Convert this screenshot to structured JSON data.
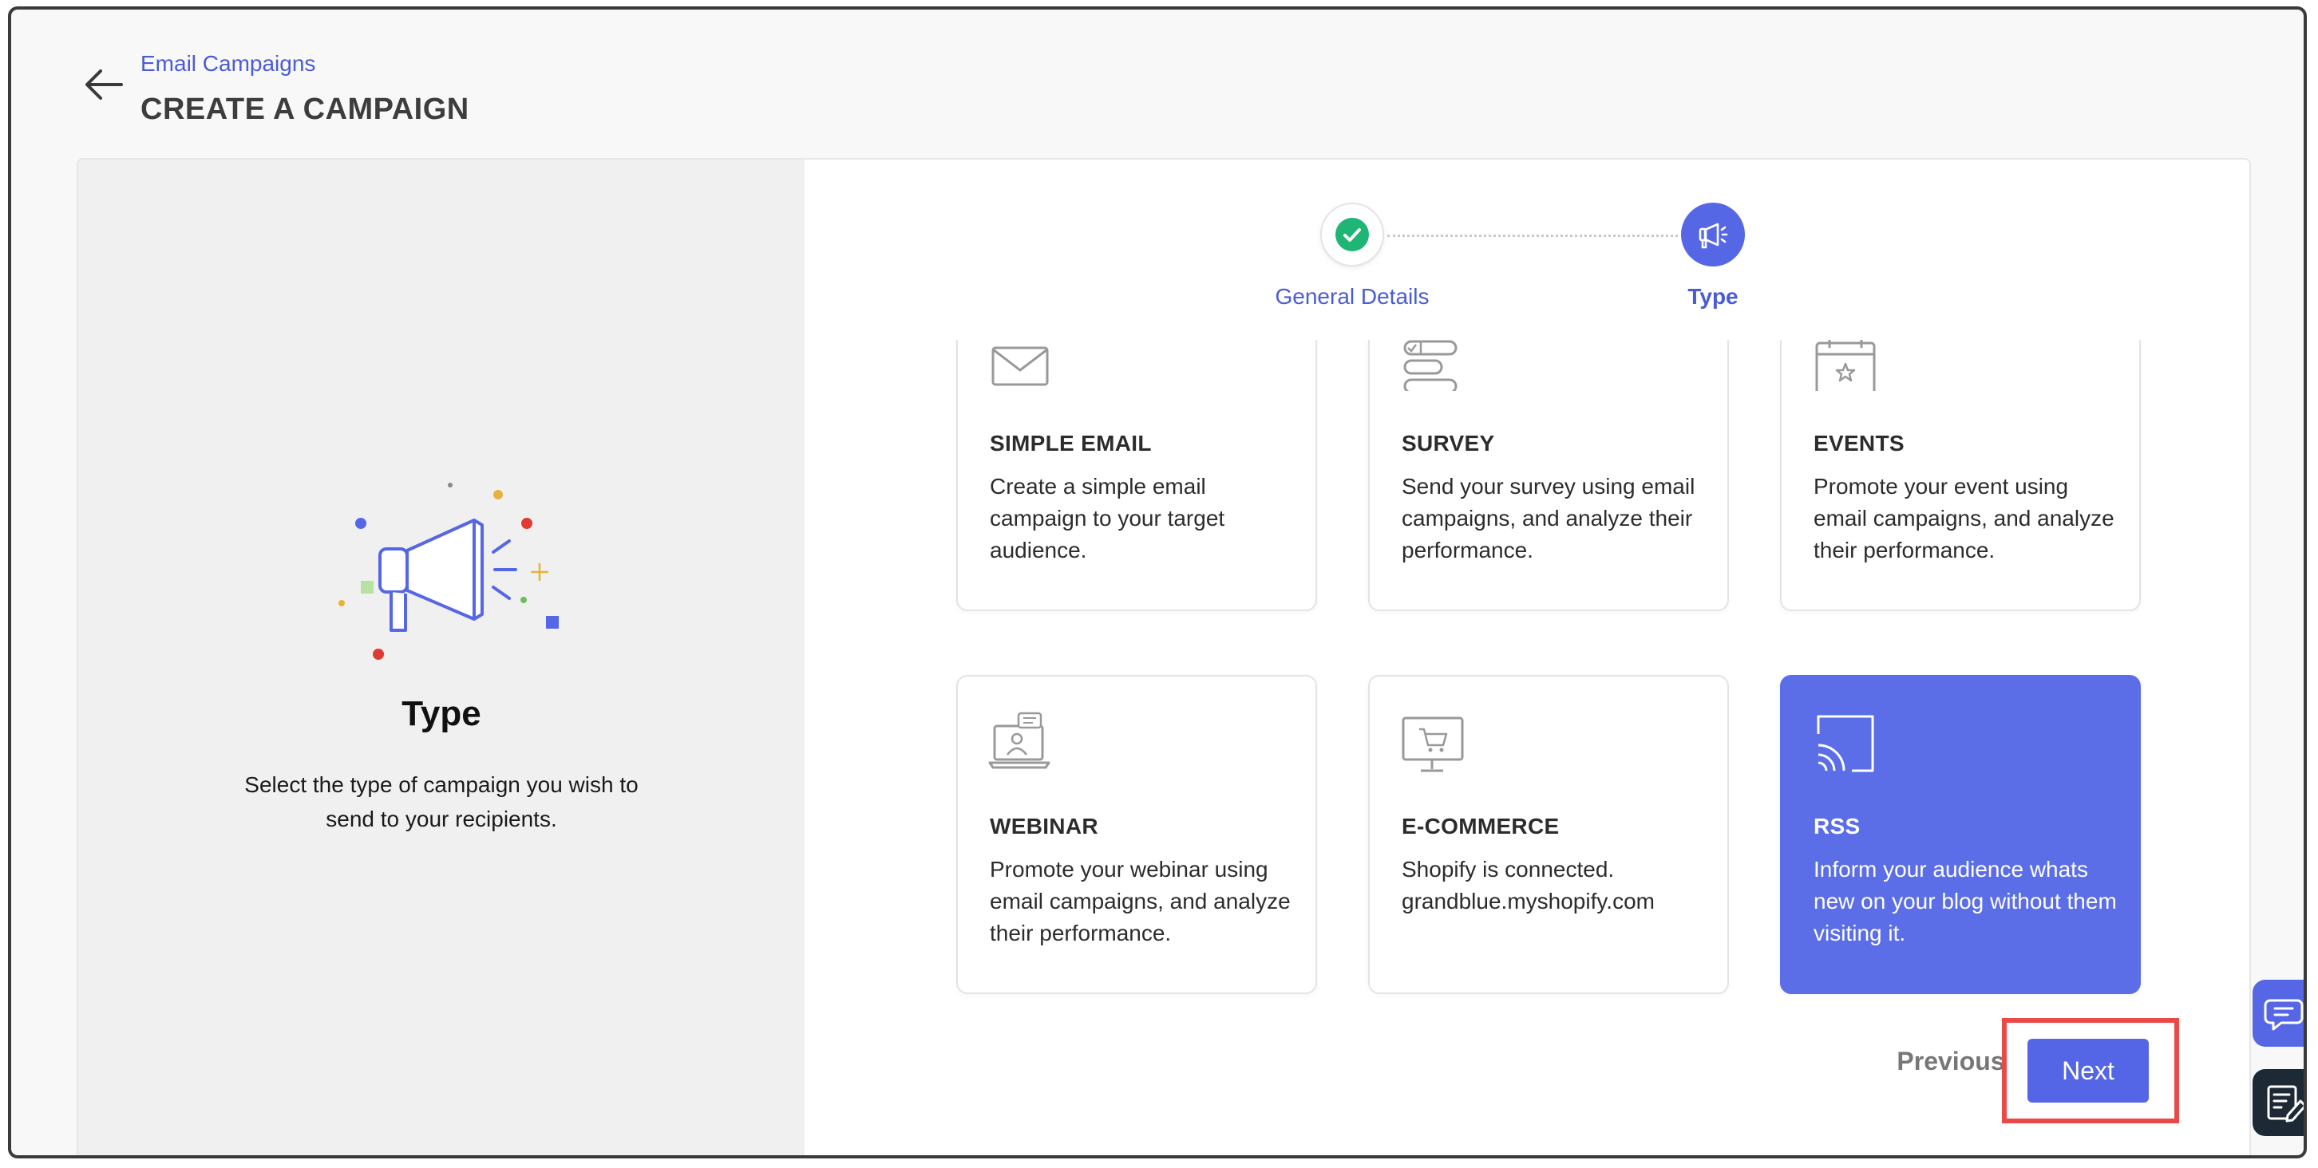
{
  "header": {
    "breadcrumb": "Email Campaigns",
    "title": "CREATE A CAMPAIGN"
  },
  "left_panel": {
    "title": "Type",
    "description": "Select the type of campaign you wish to send to your recipients."
  },
  "stepper": {
    "steps": [
      {
        "label": "General Details",
        "status": "completed"
      },
      {
        "label": "Type",
        "status": "active"
      }
    ]
  },
  "campaign_types": [
    {
      "name": "SIMPLE EMAIL",
      "description": "Create a simple email campaign to your target audience.",
      "icon": "envelope-icon",
      "selected": false
    },
    {
      "name": "SURVEY",
      "description": "Send your survey using email campaigns, and analyze their performance.",
      "icon": "survey-icon",
      "selected": false
    },
    {
      "name": "EVENTS",
      "description": "Promote your event using email campaigns, and analyze their performance.",
      "icon": "calendar-star-icon",
      "selected": false
    },
    {
      "name": "WEBINAR",
      "description": "Promote your webinar using email campaigns, and analyze their performance.",
      "icon": "webinar-icon",
      "selected": false
    },
    {
      "name": "E-COMMERCE",
      "description": "Shopify is connected. grandblue.myshopify.com",
      "icon": "cart-monitor-icon",
      "selected": false
    },
    {
      "name": "RSS",
      "description": "Inform your audience whats new on your blog without them visiting it.",
      "icon": "rss-icon",
      "selected": true
    }
  ],
  "footer": {
    "previous_label": "Previous",
    "next_label": "Next"
  },
  "colors": {
    "accent": "#5667e6",
    "success": "#1fb574",
    "highlight": "#ea4a47"
  }
}
